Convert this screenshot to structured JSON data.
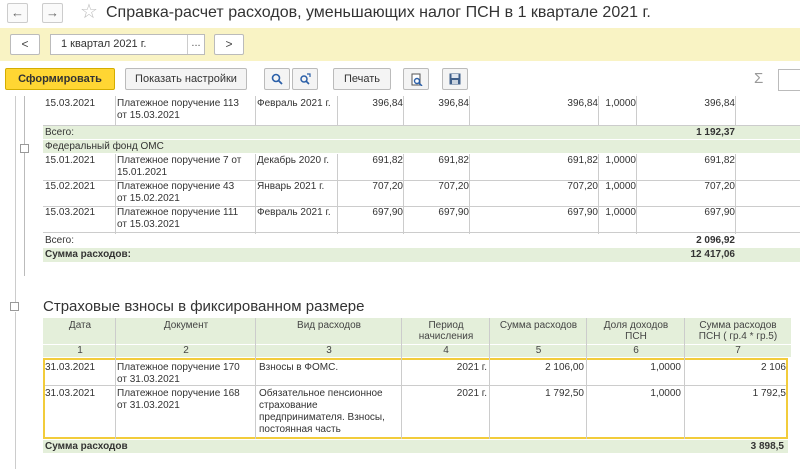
{
  "title": {
    "back": "←",
    "forward": "→",
    "star": "☆",
    "text": "Справка-расчет расходов, уменьшающих налог ПСН в 1 квартале 2021 г."
  },
  "period": {
    "prev": "<",
    "value": "1 квартал 2021 г.",
    "dots": "...",
    "next": ">"
  },
  "toolbar": {
    "generate": "Сформировать",
    "settings": "Показать настройки",
    "print": "Печать",
    "sigma": "Σ"
  },
  "part1": {
    "top_row": {
      "date": "15.03.2021",
      "doc_line1": "Платежное поручение 113",
      "doc_line2": "от 15.03.2021",
      "period": "Февраль 2021 г.",
      "c1": "396,84",
      "c2": "396,84",
      "c3": "396,84",
      "share": "1,0000",
      "total": "396,84"
    },
    "total1": {
      "label": "Всего:",
      "value": "1 192,37"
    },
    "fund": "Федеральный фонд ОМС",
    "rows": [
      {
        "date": "15.01.2021",
        "doc_line1": "Платежное поручение 7 от",
        "doc_line2": "15.01.2021",
        "period": "Декабрь 2020 г.",
        "c1": "691,82",
        "c2": "691,82",
        "c3": "691,82",
        "share": "1,0000",
        "total": "691,82"
      },
      {
        "date": "15.02.2021",
        "doc_line1": "Платежное поручение 43",
        "doc_line2": "от 15.02.2021",
        "period": "Январь 2021 г.",
        "c1": "707,20",
        "c2": "707,20",
        "c3": "707,20",
        "share": "1,0000",
        "total": "707,20"
      },
      {
        "date": "15.03.2021",
        "doc_line1": "Платежное поручение 111",
        "doc_line2": "от 15.03.2021",
        "period": "Февраль 2021 г.",
        "c1": "697,90",
        "c2": "697,90",
        "c3": "697,90",
        "share": "1,0000",
        "total": "697,90"
      }
    ],
    "total2": {
      "label": "Всего:",
      "value": "2 096,92"
    },
    "sum": {
      "label": "Сумма расходов:",
      "value": "12 417,06"
    }
  },
  "part2": {
    "title": "Страховые взносы в фиксированном размере",
    "headers": {
      "date": "Дата",
      "doc": "Документ",
      "type": "Вид расходов",
      "period_l1": "Период",
      "period_l2": "начисления",
      "amount": "Сумма расходов",
      "share_l1": "Доля доходов",
      "share_l2": "ПСН",
      "total_l1": "Сумма расходов",
      "total_l2": "ПСН ( гр.4 * гр.5)"
    },
    "nums": [
      "1",
      "2",
      "3",
      "4",
      "5",
      "6",
      "7"
    ],
    "rows": [
      {
        "date": "31.03.2021",
        "doc_line1": "Платежное поручение 170",
        "doc_line2": "от 31.03.2021",
        "type_lines": [
          "Взносы в ФОМС."
        ],
        "period": "2021 г.",
        "amount": "2 106,00",
        "share": "1,0000",
        "total": "2 106"
      },
      {
        "date": "31.03.2021",
        "doc_line1": "Платежное поручение 168",
        "doc_line2": "от 31.03.2021",
        "type_lines": [
          "Обязательное пенсионное",
          "страхование",
          "предпринимателя. Взносы,",
          "постоянная часть"
        ],
        "period": "2021 г.",
        "amount": "1 792,50",
        "share": "1,0000",
        "total": "1 792,5"
      }
    ],
    "sum": {
      "label": "Сумма расходов",
      "value": "3 898,5"
    }
  }
}
